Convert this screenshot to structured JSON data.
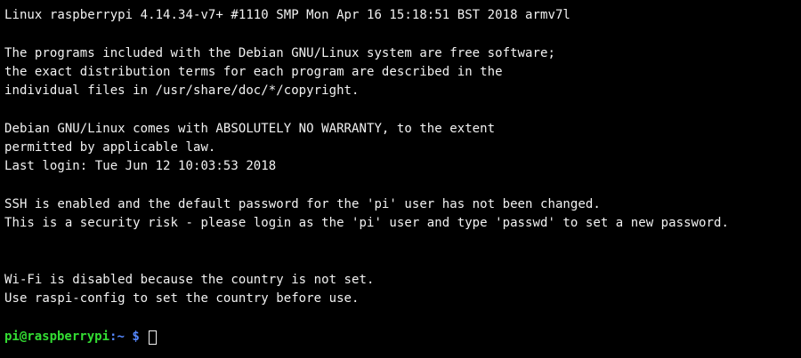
{
  "terminal": {
    "lines": [
      "Linux raspberrypi 4.14.34-v7+ #1110 SMP Mon Apr 16 15:18:51 BST 2018 armv7l",
      "",
      "The programs included with the Debian GNU/Linux system are free software;",
      "the exact distribution terms for each program are described in the",
      "individual files in /usr/share/doc/*/copyright.",
      "",
      "Debian GNU/Linux comes with ABSOLUTELY NO WARRANTY, to the extent",
      "permitted by applicable law.",
      "Last login: Tue Jun 12 10:03:53 2018",
      "",
      "SSH is enabled and the default password for the 'pi' user has not been changed.",
      "This is a security risk - please login as the 'pi' user and type 'passwd' to set a new password.",
      "",
      "",
      "Wi-Fi is disabled because the country is not set.",
      "Use raspi-config to set the country before use.",
      ""
    ],
    "prompt": {
      "user_host": "pi@raspberrypi",
      "separator": ":",
      "path": "~",
      "symbol": " $ "
    },
    "colors": {
      "background": "#000000",
      "text": "#f2f2f2",
      "prompt_user_host": "#33dd33",
      "prompt_path": "#5588ff"
    }
  }
}
